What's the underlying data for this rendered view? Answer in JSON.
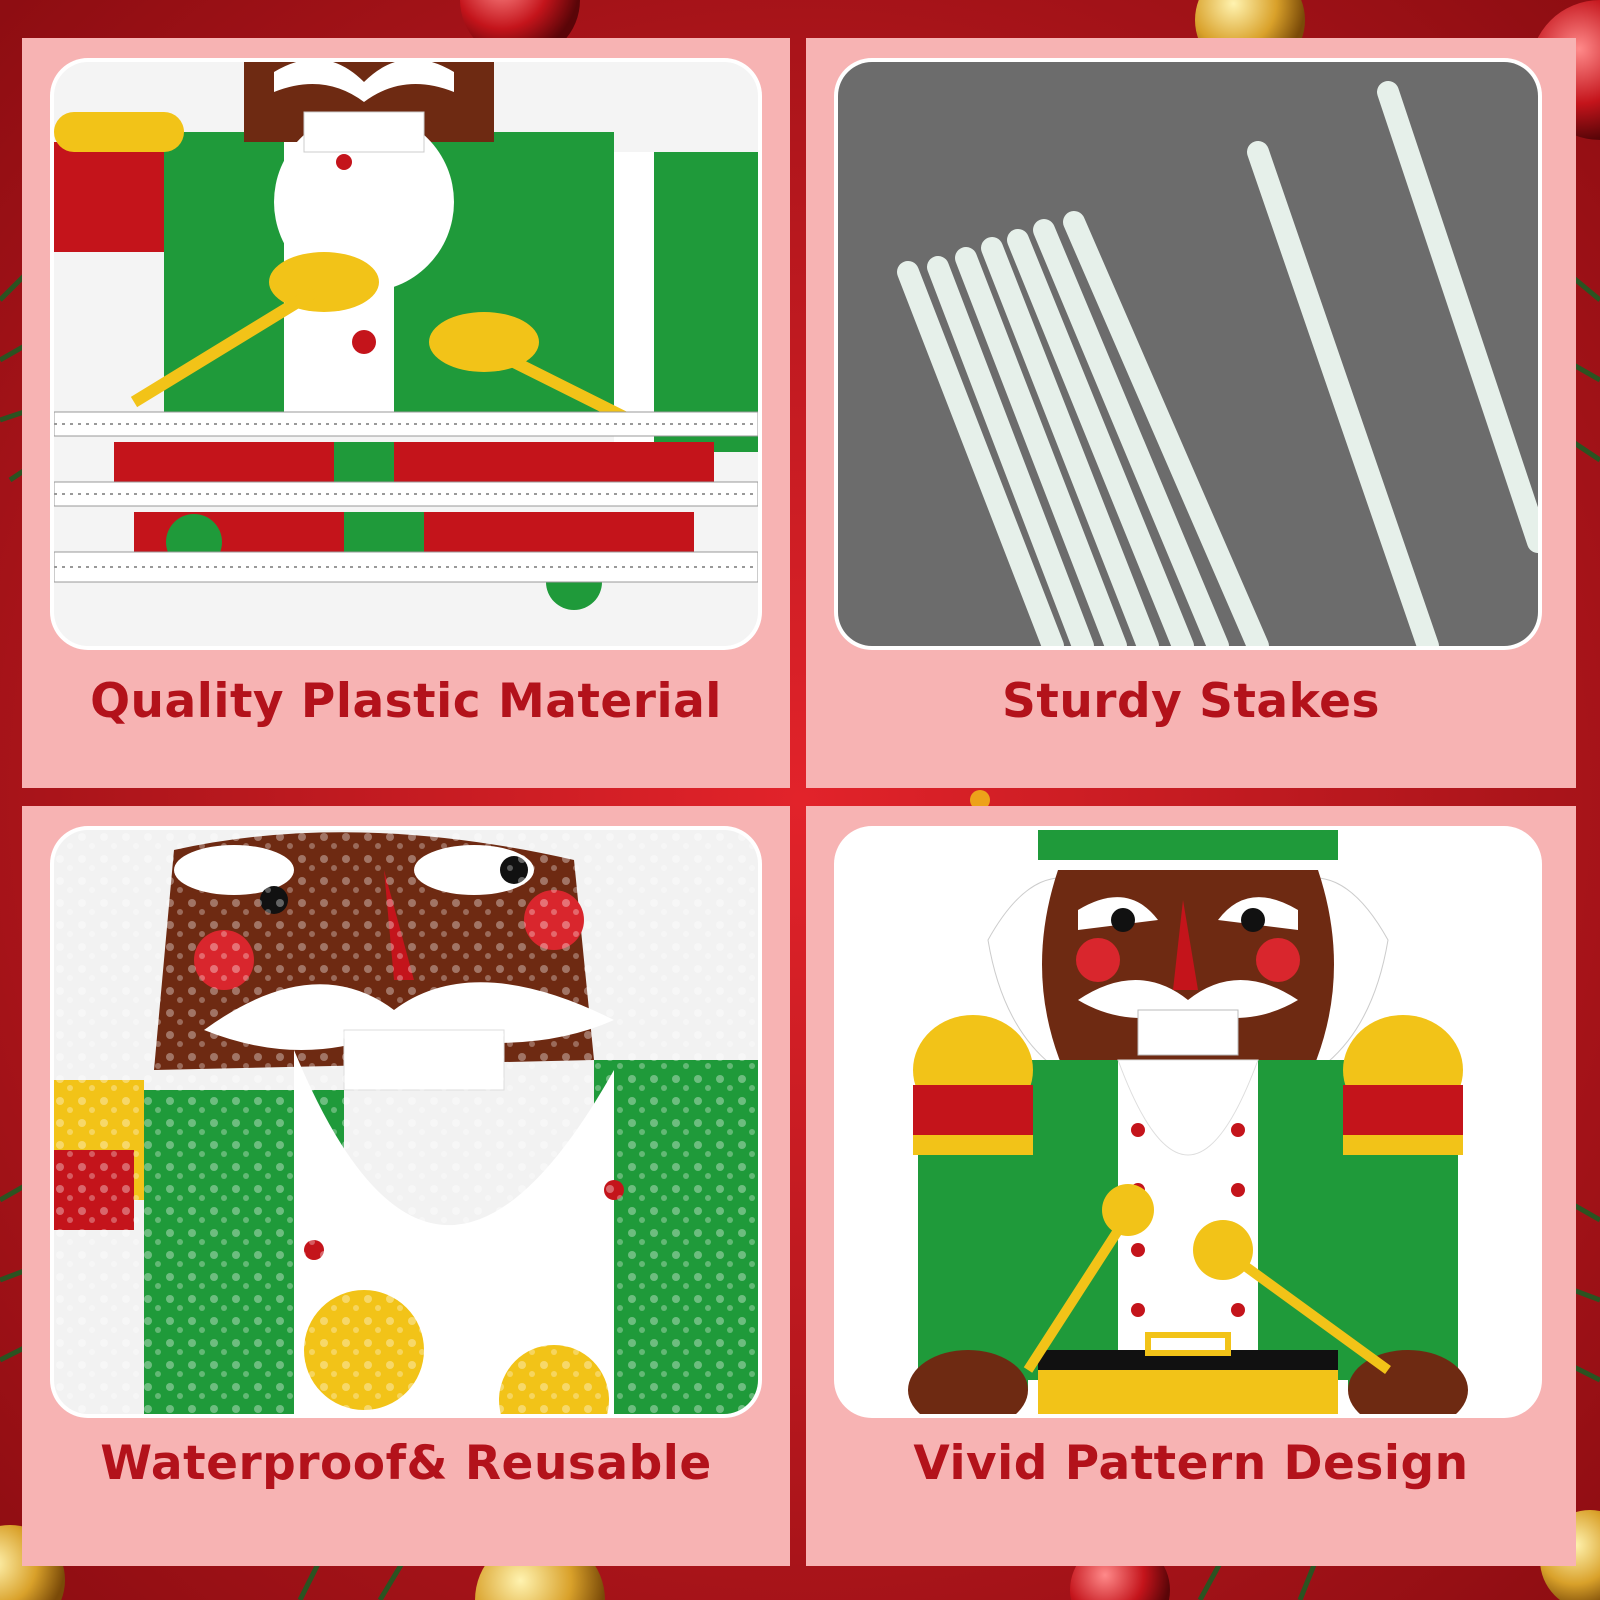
{
  "colors": {
    "background_red": "#c0151c",
    "panel_pink": "#f7b3b3",
    "caption_red": "#b3121b",
    "nutcracker_green": "#1f9a3a",
    "nutcracker_skin": "#6e2a12",
    "gold": "#f2c318"
  },
  "panels": [
    {
      "caption": "Quality Plastic Material",
      "image": "corrugated-plastic-nutcracker-closeup"
    },
    {
      "caption": "Sturdy Stakes",
      "image": "white-fiberglass-stakes-on-gray"
    },
    {
      "caption": "Waterproof& Reusable",
      "image": "water-droplets-nutcracker-face"
    },
    {
      "caption": "Vivid Pattern Design",
      "image": "full-nutcracker-drummer"
    }
  ]
}
